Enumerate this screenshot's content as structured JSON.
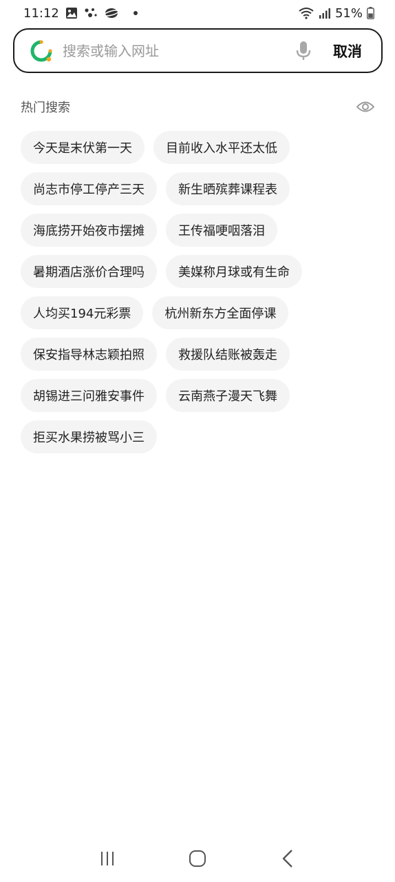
{
  "status_bar": {
    "time": "11:12",
    "battery": "51%"
  },
  "search": {
    "placeholder": "搜索或输入网址",
    "value": "",
    "cancel_label": "取消"
  },
  "hot_search": {
    "title": "热门搜索",
    "rows": [
      [
        "今天是末伏第一天",
        "目前收入水平还太低"
      ],
      [
        "尚志市停工停产三天",
        "新生晒殡葬课程表"
      ],
      [
        "海底捞开始夜市摆摊",
        "王传福哽咽落泪"
      ],
      [
        "暑期酒店涨价合理吗",
        "美媒称月球或有生命"
      ],
      [
        "人均买194元彩票",
        "杭州新东方全面停课"
      ],
      [
        "保安指导林志颖拍照",
        "救援队结账被轰走"
      ],
      [
        "胡锡进三问雅安事件",
        "云南燕子漫天飞舞"
      ],
      [
        "拒买水果捞被骂小三"
      ]
    ]
  },
  "icons": {
    "logo": "browser-logo-icon",
    "mic": "microphone-icon",
    "eye": "eye-icon",
    "recents": "recent-apps-icon",
    "home": "home-icon",
    "back": "back-icon"
  },
  "colors": {
    "logo_green": "#1fb56b",
    "logo_orange": "#f7a51c",
    "tag_bg": "#f4f4f4"
  }
}
